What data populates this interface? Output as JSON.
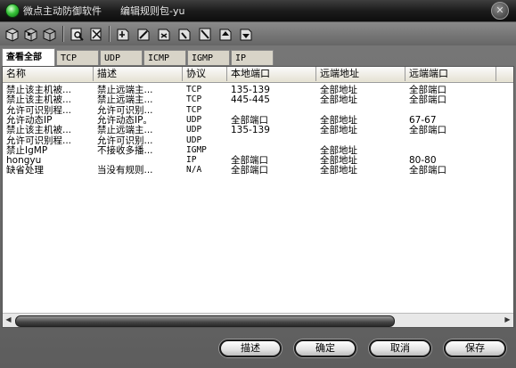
{
  "window": {
    "app_title": "微点主动防御软件",
    "subtitle": "编辑规则包-yu",
    "close_glyph": "✕"
  },
  "toolbar": {
    "icons": [
      "import-icon",
      "export-icon",
      "package-icon",
      "find-icon",
      "settings-icon",
      "rule-add-icon",
      "rule-edit-icon",
      "rule-delete-icon",
      "rule-copy-icon",
      "rule-move-icon",
      "rule-up-icon",
      "rule-down-icon"
    ]
  },
  "tabs": [
    "查看全部",
    "TCP",
    "UDP",
    "ICMP",
    "IGMP",
    "IP"
  ],
  "table": {
    "columns": [
      "名称",
      "描述",
      "协议",
      "本地端口",
      "远端地址",
      "远端端口",
      ""
    ],
    "rows": [
      [
        "禁止该主机被...",
        "禁止远端主...",
        "TCP",
        "135-139",
        "全部地址",
        "全部端口"
      ],
      [
        "禁止该主机被...",
        "禁止远端主...",
        "TCP",
        "445-445",
        "全部地址",
        "全部端口"
      ],
      [
        "允许可识别程...",
        "允许可识别...",
        "TCP",
        "",
        "",
        ""
      ],
      [
        "允许动态IP",
        "允许动态IP。",
        "UDP",
        "全部端口",
        "全部地址",
        "67-67"
      ],
      [
        "禁止该主机被...",
        "禁止远端主...",
        "UDP",
        "135-139",
        "全部地址",
        "全部端口"
      ],
      [
        "允许可识别程...",
        "允许可识别...",
        "UDP",
        "",
        "",
        ""
      ],
      [
        "禁止IgMP",
        "不接收多播...",
        "IGMP",
        "",
        "全部地址",
        ""
      ],
      [
        "hongyu",
        "",
        "IP",
        "全部端口",
        "全部地址",
        "80-80"
      ],
      [
        "缺省处理",
        "当没有规则...",
        "N/A",
        "全部端口",
        "全部地址",
        "全部端口"
      ]
    ]
  },
  "buttons": {
    "describe": "描述",
    "ok": "确定",
    "cancel": "取消",
    "save": "保存"
  },
  "scroll": {
    "left_arrow": "◀",
    "right_arrow": "▶"
  }
}
